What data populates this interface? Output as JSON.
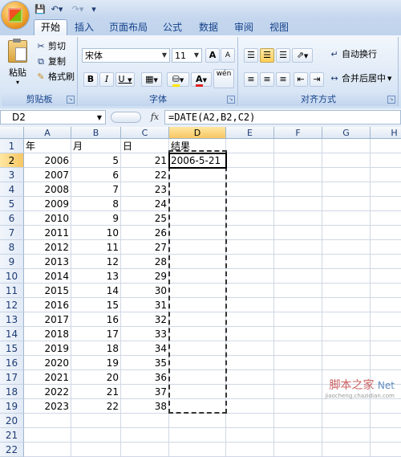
{
  "tabs": [
    "开始",
    "插入",
    "页面布局",
    "公式",
    "数据",
    "审阅",
    "视图"
  ],
  "active_tab": 0,
  "ribbon": {
    "clipboard": {
      "paste": "粘贴",
      "cut": "剪切",
      "copy": "复制",
      "format_painter": "格式刷",
      "label": "剪贴板"
    },
    "font": {
      "name": "宋体",
      "size": "11",
      "bold": "B",
      "italic": "I",
      "underline": "U",
      "grow": "A",
      "shrink": "A",
      "phonetic": "wén",
      "label": "字体"
    },
    "alignment": {
      "wrap": "自动换行",
      "merge": "合并后居中",
      "label": "对齐方式"
    }
  },
  "formula_bar": {
    "name_box": "D2",
    "fx": "fx",
    "formula": "=DATE(A2,B2,C2)"
  },
  "columns": [
    "A",
    "B",
    "C",
    "D",
    "E",
    "F",
    "G",
    "H"
  ],
  "selected_column": "D",
  "selected_row": 2,
  "headers": [
    "年",
    "月",
    "日",
    "结果"
  ],
  "rows": [
    [
      2006,
      5,
      21,
      "2006-5-21"
    ],
    [
      2007,
      6,
      22,
      ""
    ],
    [
      2008,
      7,
      23,
      ""
    ],
    [
      2009,
      8,
      24,
      ""
    ],
    [
      2010,
      9,
      25,
      ""
    ],
    [
      2011,
      10,
      26,
      ""
    ],
    [
      2012,
      11,
      27,
      ""
    ],
    [
      2013,
      12,
      28,
      ""
    ],
    [
      2014,
      13,
      29,
      ""
    ],
    [
      2015,
      14,
      30,
      ""
    ],
    [
      2016,
      15,
      31,
      ""
    ],
    [
      2017,
      16,
      32,
      ""
    ],
    [
      2018,
      17,
      33,
      ""
    ],
    [
      2019,
      18,
      34,
      ""
    ],
    [
      2020,
      19,
      35,
      ""
    ],
    [
      2021,
      20,
      36,
      ""
    ],
    [
      2022,
      21,
      37,
      ""
    ],
    [
      2023,
      22,
      38,
      ""
    ]
  ],
  "row_numbers": [
    "1",
    "2",
    "3",
    "4",
    "5",
    "6",
    "7",
    "8",
    "9",
    "10",
    "11",
    "12",
    "13",
    "14",
    "15",
    "16",
    "17",
    "18",
    "19",
    "20",
    "21",
    "22"
  ],
  "watermark": "脚本之家",
  "watermark_sub": "Net",
  "watermark_url": "jiaocheng.chazidian.com"
}
